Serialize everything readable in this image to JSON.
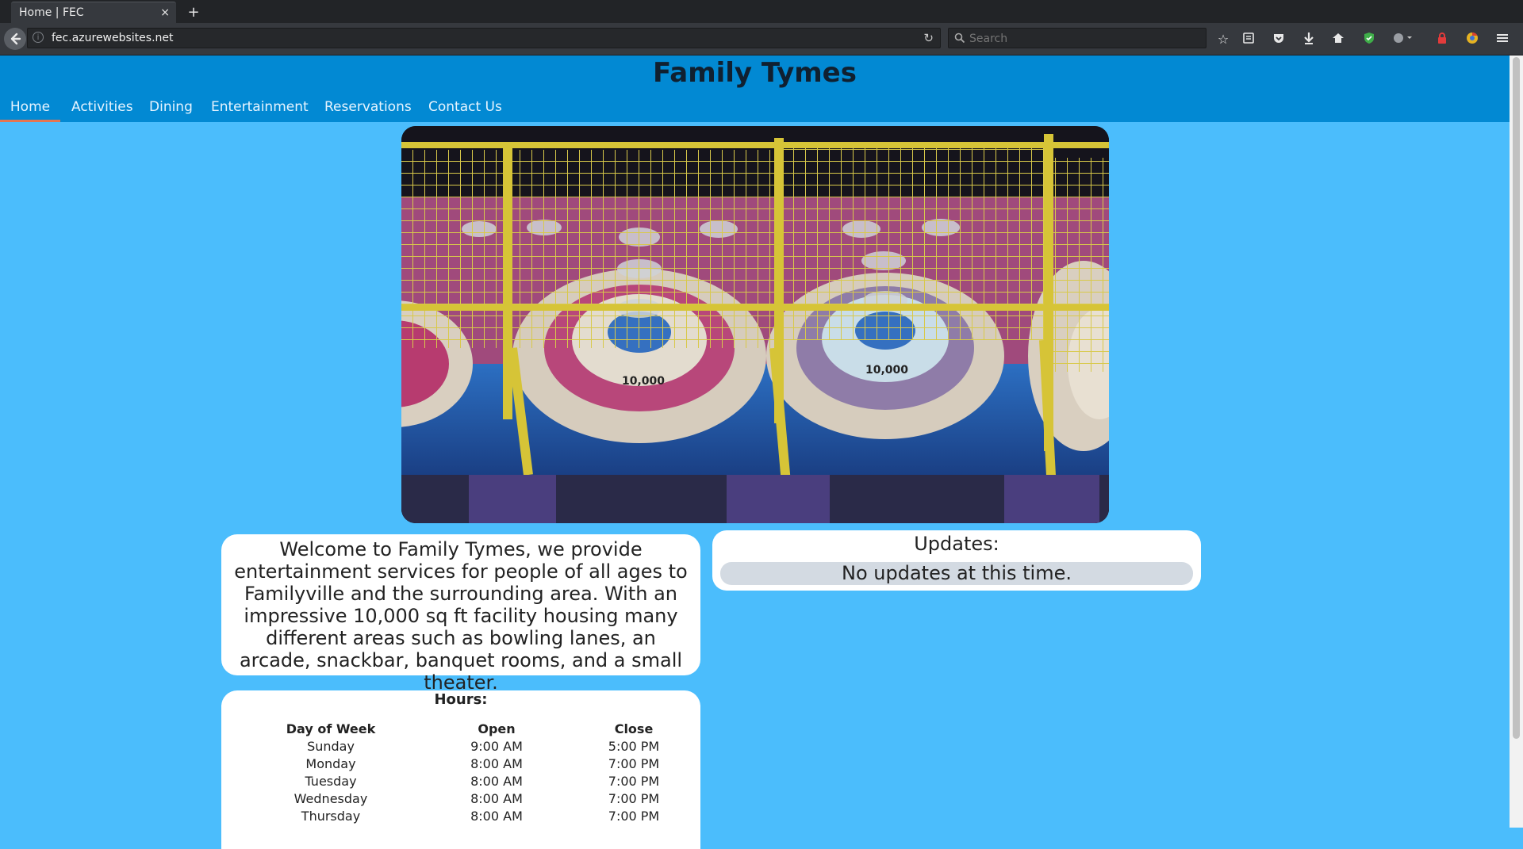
{
  "browser": {
    "tab_title": "Home | FEC",
    "tab_close": "×",
    "new_tab": "+",
    "url": "fec.azurewebsites.net",
    "search_placeholder": "Search"
  },
  "site": {
    "title": "Family Tymes",
    "nav": [
      {
        "label": "Home",
        "active": true
      },
      {
        "label": "Activities"
      },
      {
        "label": "Dining"
      },
      {
        "label": "Entertainment"
      },
      {
        "label": "Reservations"
      },
      {
        "label": "Contact Us"
      }
    ]
  },
  "welcome": {
    "text": "Welcome to Family Tymes, we provide entertainment services for people of all ages to Familyville and the surrounding area. With an impressive 10,000 sq ft facility housing many different areas such as bowling lanes, an arcade, snackbar, banquet rooms, and a small theater."
  },
  "updates": {
    "title": "Updates:",
    "message": "No updates at this time."
  },
  "hours": {
    "title": "Hours:",
    "headers": [
      "Day of Week",
      "Open",
      "Close"
    ],
    "rows": [
      [
        "Sunday",
        "9:00 AM",
        "5:00 PM"
      ],
      [
        "Monday",
        "8:00 AM",
        "7:00 PM"
      ],
      [
        "Tuesday",
        "8:00 AM",
        "7:00 PM"
      ],
      [
        "Wednesday",
        "8:00 AM",
        "7:00 PM"
      ],
      [
        "Thursday",
        "8:00 AM",
        "7:00 PM"
      ]
    ]
  },
  "hero_image": {
    "score_labels": [
      "10,000",
      "10,000"
    ]
  },
  "colors": {
    "page_bg": "#4bbdfc",
    "header_bg": "#0289d3",
    "nav_active_underline": "#e37552"
  }
}
